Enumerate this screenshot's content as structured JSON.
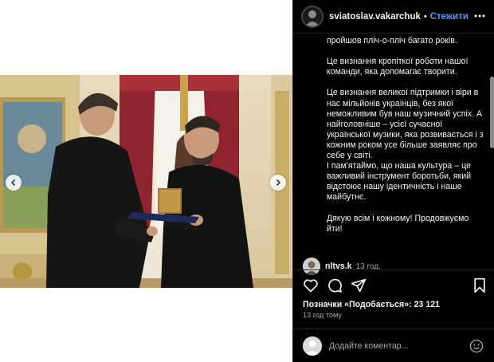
{
  "post": {
    "username": "sviatoslav.vakarchuk",
    "separator": "•",
    "follow_label": "Стежити"
  },
  "caption": {
    "paragraphs": [
      "пройшов пліч-о-пліч багато років.",
      "Це визнання кропіткої роботи нашої команди, яка допомагає творити.",
      "Це визнання великої підтримки і віри в нас мільйонів українців, без якої неможливим був наш музичний успіх. А найголовніше – усієї сучасної української музики, яка розвивається і з кожним роком усе більше заявляє про себе у світі.",
      "І пам'ятаймо, що наша культура – це важливий інструмент боротьби, який відстоює нашу ідентичність і наше майбутнє.",
      "Дякую всім і кожному! Продовжуємо йти!"
    ]
  },
  "comment": {
    "username": "nltvs.k",
    "time": "13 год."
  },
  "stats": {
    "likes_text": "Позначки «Подобається»: 23 121",
    "time_ago": "13 год тому"
  },
  "comment_input": {
    "placeholder": "Додайте коментар..."
  },
  "icons": {
    "carousel_prev": "chevron-left-icon",
    "carousel_next": "chevron-right-icon",
    "more": "more-horizontal-icon",
    "like": "heart-icon",
    "comment": "comment-icon",
    "share": "paper-plane-icon",
    "save": "bookmark-icon",
    "emoji": "emoji-icon"
  },
  "colors": {
    "side_background": "#000000",
    "follow_link": "#4a9df8",
    "secondary_text": "#a8a8a8"
  }
}
